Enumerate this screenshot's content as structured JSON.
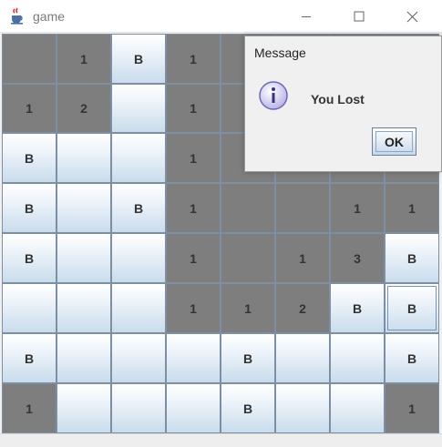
{
  "window": {
    "title": "game",
    "icon": "java-cup-icon",
    "controls": [
      "minimize-icon",
      "maximize-icon",
      "close-icon"
    ]
  },
  "board": {
    "rows": 8,
    "cols": 8,
    "cells": [
      [
        {
          "state": "revealed",
          "label": ""
        },
        {
          "state": "revealed",
          "label": "1"
        },
        {
          "state": "covered",
          "label": "B"
        },
        {
          "state": "revealed",
          "label": "1"
        },
        {
          "state": "revealed",
          "label": ""
        },
        {
          "state": "revealed",
          "label": ""
        },
        {
          "state": "revealed",
          "label": ""
        },
        {
          "state": "revealed",
          "label": ""
        }
      ],
      [
        {
          "state": "revealed",
          "label": "1"
        },
        {
          "state": "revealed",
          "label": "2"
        },
        {
          "state": "covered",
          "label": ""
        },
        {
          "state": "revealed",
          "label": "1"
        },
        {
          "state": "revealed",
          "label": ""
        },
        {
          "state": "revealed",
          "label": ""
        },
        {
          "state": "revealed",
          "label": ""
        },
        {
          "state": "revealed",
          "label": ""
        }
      ],
      [
        {
          "state": "covered",
          "label": "B"
        },
        {
          "state": "covered",
          "label": ""
        },
        {
          "state": "covered",
          "label": ""
        },
        {
          "state": "revealed",
          "label": "1"
        },
        {
          "state": "revealed",
          "label": ""
        },
        {
          "state": "revealed",
          "label": ""
        },
        {
          "state": "revealed",
          "label": ""
        },
        {
          "state": "revealed",
          "label": ""
        }
      ],
      [
        {
          "state": "covered",
          "label": "B"
        },
        {
          "state": "covered",
          "label": ""
        },
        {
          "state": "covered",
          "label": "B"
        },
        {
          "state": "revealed",
          "label": "1"
        },
        {
          "state": "revealed",
          "label": ""
        },
        {
          "state": "revealed",
          "label": ""
        },
        {
          "state": "revealed",
          "label": "1"
        },
        {
          "state": "revealed",
          "label": "1"
        }
      ],
      [
        {
          "state": "covered",
          "label": "B"
        },
        {
          "state": "covered",
          "label": ""
        },
        {
          "state": "covered",
          "label": ""
        },
        {
          "state": "revealed",
          "label": "1"
        },
        {
          "state": "revealed",
          "label": ""
        },
        {
          "state": "revealed",
          "label": "1"
        },
        {
          "state": "revealed",
          "label": "3"
        },
        {
          "state": "covered",
          "label": "B"
        }
      ],
      [
        {
          "state": "covered",
          "label": ""
        },
        {
          "state": "covered",
          "label": ""
        },
        {
          "state": "covered",
          "label": ""
        },
        {
          "state": "revealed",
          "label": "1"
        },
        {
          "state": "revealed",
          "label": "1"
        },
        {
          "state": "revealed",
          "label": "2"
        },
        {
          "state": "covered",
          "label": "B"
        },
        {
          "state": "covered",
          "label": "B",
          "focused": true
        }
      ],
      [
        {
          "state": "covered",
          "label": "B"
        },
        {
          "state": "covered",
          "label": ""
        },
        {
          "state": "covered",
          "label": ""
        },
        {
          "state": "covered",
          "label": ""
        },
        {
          "state": "covered",
          "label": "B"
        },
        {
          "state": "covered",
          "label": ""
        },
        {
          "state": "covered",
          "label": ""
        },
        {
          "state": "covered",
          "label": "B"
        }
      ],
      [
        {
          "state": "revealed",
          "label": "1"
        },
        {
          "state": "covered",
          "label": ""
        },
        {
          "state": "covered",
          "label": ""
        },
        {
          "state": "covered",
          "label": ""
        },
        {
          "state": "covered",
          "label": "B"
        },
        {
          "state": "covered",
          "label": ""
        },
        {
          "state": "covered",
          "label": ""
        },
        {
          "state": "revealed",
          "label": "1"
        }
      ]
    ]
  },
  "dialog": {
    "title": "Message",
    "icon": "info-icon",
    "message": "You Lost",
    "ok_label": "OK"
  },
  "colors": {
    "revealed_cell": "#7e7e7e",
    "grid_line": "#7d8fa3",
    "covered_top": "#ffffff",
    "covered_bottom": "#c9dcec"
  }
}
